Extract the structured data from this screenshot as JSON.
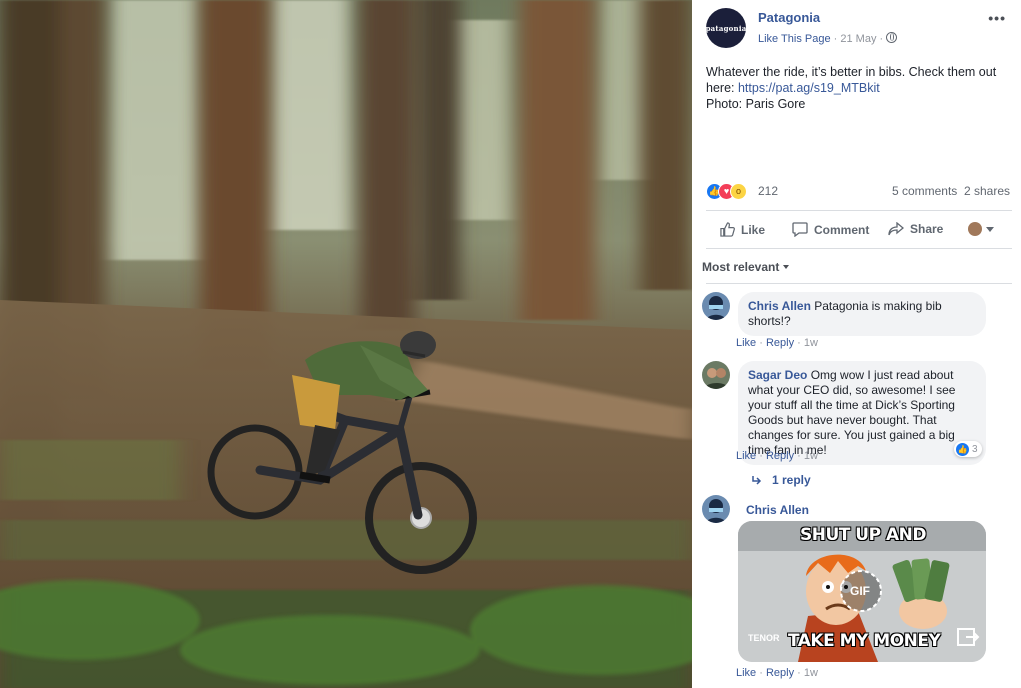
{
  "post": {
    "page_name": "Patagonia",
    "page_logo_text": "patagonia",
    "like_page": "Like This Page",
    "date": "21 May",
    "text_line1": "Whatever the ride, it’s better in bibs. Check them out here: ",
    "link": "https://pat.ag/s19_MTBkit",
    "text_line2": "Photo: Paris Gore",
    "reaction_count": "212",
    "comments_count": "5 comments",
    "shares_count": "2 shares",
    "reaction_icons": [
      "like-icon",
      "love-icon",
      "wow-icon"
    ]
  },
  "actions": {
    "like": "Like",
    "comment": "Comment",
    "share": "Share"
  },
  "comments_sort": "Most relevant",
  "comments": [
    {
      "author": "Chris Allen",
      "text": "Patagonia is making bib shorts!?",
      "like": "Like",
      "reply": "Reply",
      "time": "1w"
    },
    {
      "author": "Sagar Deo",
      "text": "Omg wow I just read about what your CEO did, so awesome! I see your stuff all the time at Dick’s Sporting Goods but have never bought. That changes for sure. You just gained a big time fan in me!",
      "like": "Like",
      "reply": "Reply",
      "time": "1w",
      "reaction_count": "3",
      "replies": "1 reply"
    },
    {
      "author": "Chris Allen",
      "gif_top": "SHUT UP AND",
      "gif_bottom": "TAKE MY MONEY",
      "gif_badge": "GIF",
      "gif_brand": "TENOR",
      "like": "Like",
      "reply": "Reply",
      "time": "1w"
    }
  ],
  "colors": {
    "link": "#385898",
    "meta": "#90949c",
    "bubble": "#f2f3f5",
    "like_blue": "#1877f2",
    "love_red": "#f33e58"
  }
}
